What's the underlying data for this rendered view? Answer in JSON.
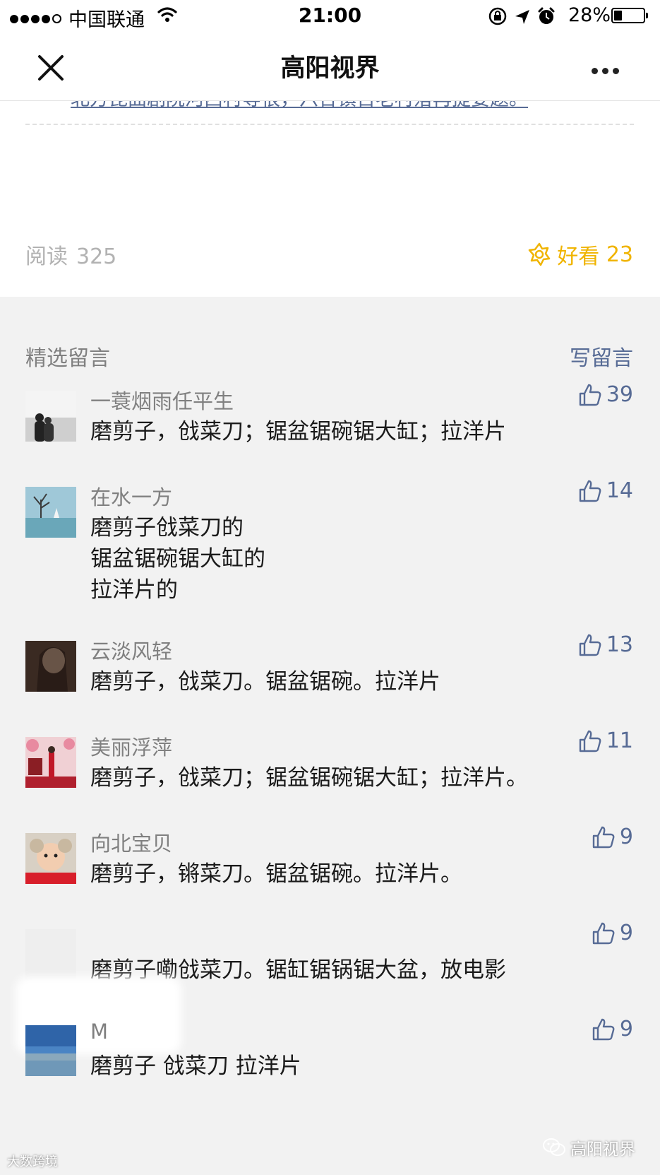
{
  "status_bar": {
    "carrier": "中国联通",
    "time": "21:00",
    "battery": "28%",
    "battery_level": 0.28
  },
  "nav": {
    "title": "高阳视界",
    "close_icon": "close-icon",
    "more_icon": "more-icon"
  },
  "article": {
    "tail_link": "北方昆曲剧院河西村等很，六合镇百老村落再提要题。",
    "read_label": "阅读",
    "read_count": "325",
    "wow_label": "好看",
    "wow_count": "23",
    "wow_color": "#f0b400"
  },
  "comments": {
    "header": "精选留言",
    "write_label": "写留言",
    "link_color": "#576b95",
    "items": [
      {
        "name": "一蓑烟雨任平生",
        "text": "磨剪子，戗菜刀；锯盆锯碗锯大缸；拉洋片",
        "likes": "39"
      },
      {
        "name": "在水一方",
        "text": "磨剪子戗菜刀的\n锯盆锯碗锯大缸的\n拉洋片的",
        "likes": "14"
      },
      {
        "name": "云淡风轻",
        "text": "磨剪子，戗菜刀。锯盆锯碗。拉洋片",
        "likes": "13"
      },
      {
        "name": "美丽浮萍",
        "text": "磨剪子，戗菜刀；锯盆锯碗锯大缸；拉洋片。",
        "likes": "11"
      },
      {
        "name": "向北宝贝",
        "text": "磨剪子，锵菜刀。锯盆锯碗。拉洋片。",
        "likes": "9"
      },
      {
        "name": "",
        "text": "磨剪子嘞戗菜刀。锯缸锯锅锯大盆，放电影",
        "likes": "9"
      },
      {
        "name": "M",
        "text": "磨剪子  戗菜刀   拉洋片",
        "likes": "9"
      }
    ]
  },
  "watermarks": {
    "right": "高阳视界",
    "left": "大数跨境"
  }
}
